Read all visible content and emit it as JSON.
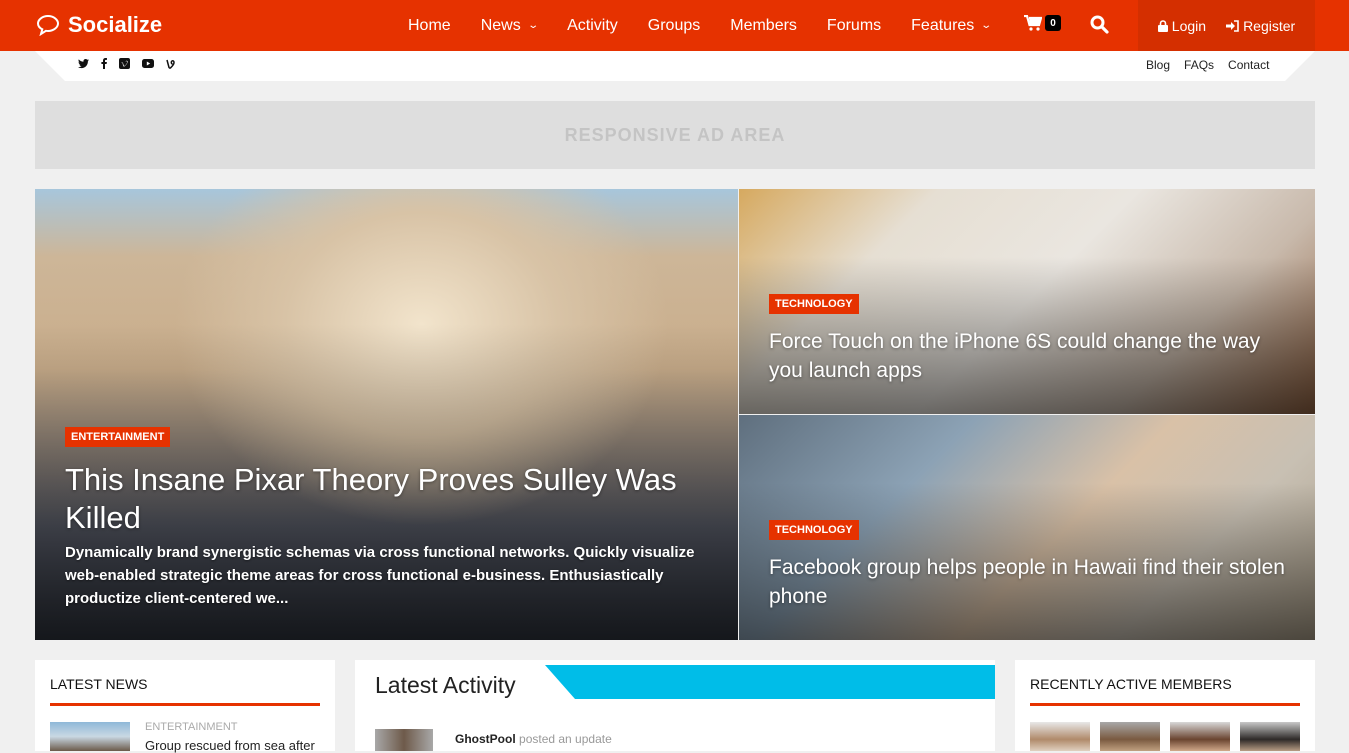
{
  "brand": {
    "name": "Socialize",
    "accent": "#e63200",
    "activity_accent": "#00bde8"
  },
  "nav": {
    "items": [
      {
        "label": "Home",
        "dropdown": false
      },
      {
        "label": "News",
        "dropdown": true
      },
      {
        "label": "Activity",
        "dropdown": false
      },
      {
        "label": "Groups",
        "dropdown": false
      },
      {
        "label": "Members",
        "dropdown": false
      },
      {
        "label": "Forums",
        "dropdown": false
      },
      {
        "label": "Features",
        "dropdown": true
      }
    ],
    "cart_count": "0",
    "login_label": "Login",
    "register_label": "Register"
  },
  "subbar": {
    "social": [
      "twitter-icon",
      "facebook-icon",
      "vimeo-icon",
      "youtube-icon",
      "vine-icon"
    ],
    "links": [
      "Blog",
      "FAQs",
      "Contact"
    ]
  },
  "ad": {
    "label": "RESPONSIVE AD AREA"
  },
  "hero": {
    "main": {
      "category": "ENTERTAINMENT",
      "title": "This Insane Pixar Theory Proves Sulley Was Killed",
      "excerpt": "Dynamically brand synergistic schemas via cross functional networks. Quickly visualize web-enabled strategic theme areas for cross functional e-business. Enthusiastically productize client-centered we..."
    },
    "top": {
      "category": "TECHNOLOGY",
      "title": "Force Touch on the iPhone 6S could change the way you launch apps"
    },
    "bottom": {
      "category": "TECHNOLOGY",
      "title": "Facebook group helps people in Hawaii find their stolen phone"
    }
  },
  "latest_news": {
    "title": "LATEST NEWS",
    "items": [
      {
        "category": "ENTERTAINMENT",
        "title": "Group rescued from sea after"
      }
    ]
  },
  "latest_activity": {
    "title": "Latest Activity",
    "items": [
      {
        "user": "GhostPool",
        "action": "posted an update"
      }
    ]
  },
  "active_members": {
    "title": "RECENTLY ACTIVE MEMBERS",
    "count_visible": 4
  }
}
